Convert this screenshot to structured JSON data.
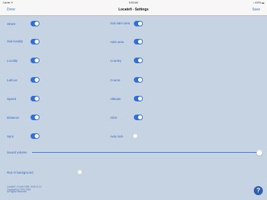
{
  "statusbar": {
    "carrier": "Carrier ✈",
    "time": "8:53 AM",
    "battery": "▪ 100% ▬"
  },
  "navbar": {
    "done": "Done",
    "title": "Locatefi - Settings",
    "save": "Save"
  },
  "left_settings": [
    {
      "label": "Street",
      "on": true
    },
    {
      "label": "Sub locality",
      "on": true
    },
    {
      "label": "Locality",
      "on": true
    },
    {
      "label": "Lat/Lon",
      "on": true
    },
    {
      "label": "Speed",
      "on": true
    },
    {
      "label": "Distance",
      "on": true
    },
    {
      "label": "Sync",
      "on": true
    }
  ],
  "right_settings": [
    {
      "label": "Sub adm area",
      "on": true
    },
    {
      "label": "Adm area",
      "on": true
    },
    {
      "label": "Country",
      "on": true
    },
    {
      "label": "Course",
      "on": true
    },
    {
      "label": "Altitude",
      "on": true
    },
    {
      "label": "Click",
      "on": true
    },
    {
      "label": "Auto lock",
      "on": false
    }
  ],
  "sound_volume": {
    "label": "Sound volume",
    "value": 1.0
  },
  "run_background": {
    "label": "Run in background",
    "on": false
  },
  "footer": {
    "line1": "Locatefi 1.2 build 1298, 2015-11-21",
    "line2": "Copyright (c) 2011-2015",
    "line3": "All Rights Reserved"
  },
  "help_icon": "?"
}
